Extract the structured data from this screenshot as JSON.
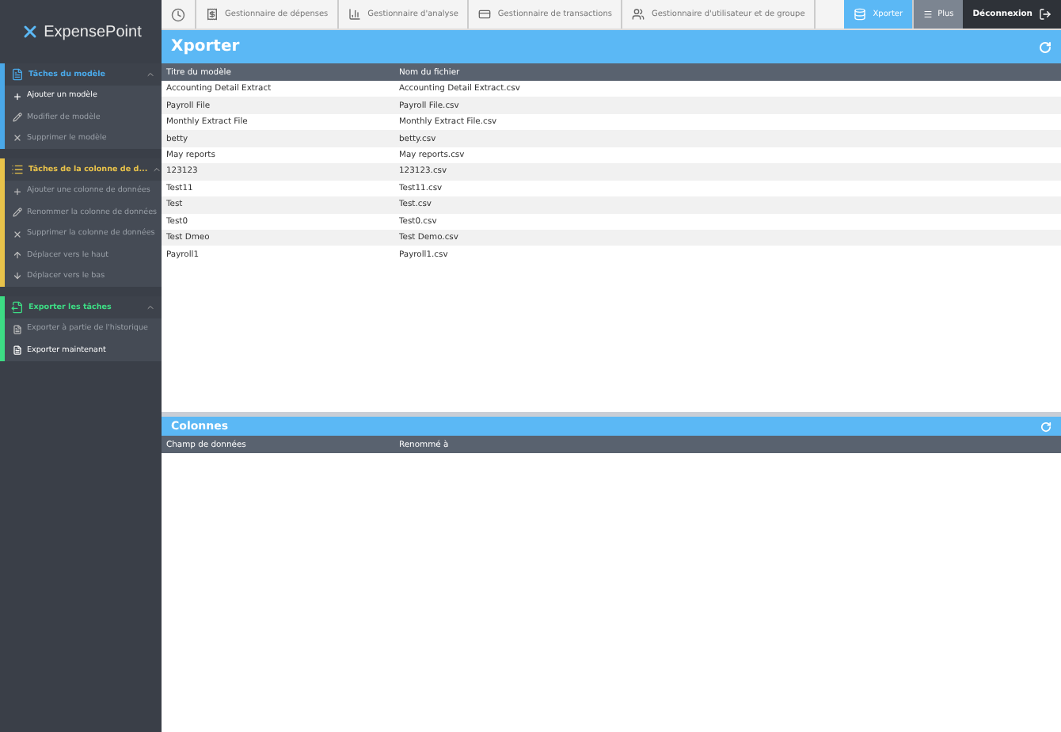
{
  "app": {
    "logo": "ExpensePoint"
  },
  "sidebar": {
    "sections": [
      {
        "title": "Tâches du modèle",
        "color": "#4aa8e8",
        "expanded": true,
        "items": [
          {
            "label": "Ajouter un modèle",
            "kind": "add",
            "disabled": false
          },
          {
            "label": "Modifier de modèle",
            "kind": "edit",
            "disabled": true
          },
          {
            "label": "Supprimer le modèle",
            "kind": "delete",
            "disabled": true
          }
        ]
      },
      {
        "title": "Tâches de la colonne de d...",
        "color": "#e8c24a",
        "expanded": true,
        "items": [
          {
            "label": "Ajouter une colonne de données",
            "kind": "add",
            "disabled": true
          },
          {
            "label": "Renommer la colonne de données",
            "kind": "edit",
            "disabled": true
          },
          {
            "label": "Supprimer la colonne de données",
            "kind": "delete",
            "disabled": true
          },
          {
            "label": "Déplacer vers le haut",
            "kind": "up",
            "disabled": true
          },
          {
            "label": "Déplacer vers le bas",
            "kind": "down",
            "disabled": true
          }
        ]
      },
      {
        "title": "Exporter les tâches",
        "color": "#3ddc84",
        "expanded": true,
        "items": [
          {
            "label": "Exporter à partie de l'historique",
            "kind": "doc",
            "disabled": true
          },
          {
            "label": "Exporter maintenant",
            "kind": "doc",
            "disabled": false
          }
        ]
      }
    ]
  },
  "nav": {
    "items": [
      {
        "label": "Gestionnaire de dépenses",
        "selected": false
      },
      {
        "label": "Gestionnaire d'analyse",
        "selected": false
      },
      {
        "label": "Gestionnaire de transactions",
        "selected": false
      },
      {
        "label": "Gestionnaire d'utilisateur et de groupe",
        "selected": false
      },
      {
        "label": "Xporter",
        "selected": true
      }
    ],
    "more": "Plus",
    "logout": "Déconnexion"
  },
  "templates": {
    "title": "Xporter",
    "columns": [
      "Titre du modèle",
      "Nom du fichier"
    ],
    "rows": [
      [
        "Accounting Detail Extract",
        "Accounting Detail Extract.csv"
      ],
      [
        "Payroll File",
        "Payroll File.csv"
      ],
      [
        "Monthly Extract File",
        "Monthly Extract File.csv"
      ],
      [
        "betty",
        "betty.csv"
      ],
      [
        "May reports",
        "May reports.csv"
      ],
      [
        "123123",
        "123123.csv"
      ],
      [
        "Test11",
        "Test11.csv"
      ],
      [
        "Test",
        "Test.csv"
      ],
      [
        "Test0",
        "Test0.csv"
      ],
      [
        "Test Dmeo",
        "Test Demo.csv"
      ],
      [
        "Payroll1",
        "Payroll1.csv"
      ]
    ]
  },
  "columns_panel": {
    "title": "Colonnes",
    "columns": [
      "Champ de données",
      "Renommé à"
    ]
  }
}
